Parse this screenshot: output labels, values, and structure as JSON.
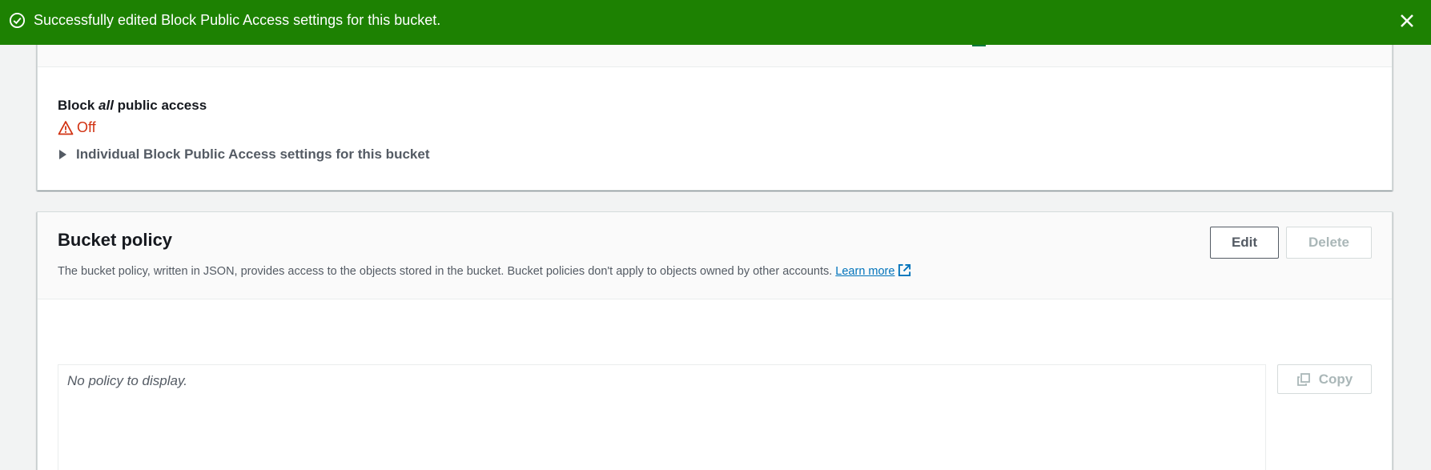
{
  "flash": {
    "message": "Successfully edited Block Public Access settings for this bucket.",
    "status": "success",
    "color": "#1d8102"
  },
  "block_public_access": {
    "label_prefix": "Block ",
    "label_emphasis": "all",
    "label_suffix": " public access",
    "status": "Off",
    "status_color": "#d13212",
    "expander_label": "Individual Block Public Access settings for this bucket"
  },
  "bucket_policy": {
    "title": "Bucket policy",
    "description": "The bucket policy, written in JSON, provides access to the objects stored in the bucket. Bucket policies don't apply to objects owned by other accounts.",
    "learn_more": "Learn more",
    "edit_label": "Edit",
    "delete_label": "Delete",
    "empty_text": "No policy to display.",
    "copy_label": "Copy"
  },
  "icons": {
    "flash": "check-circle-icon",
    "close": "close-icon",
    "warning": "warning-icon",
    "expander": "caret-right-icon",
    "external": "external-link-icon",
    "copy": "copy-icon"
  }
}
